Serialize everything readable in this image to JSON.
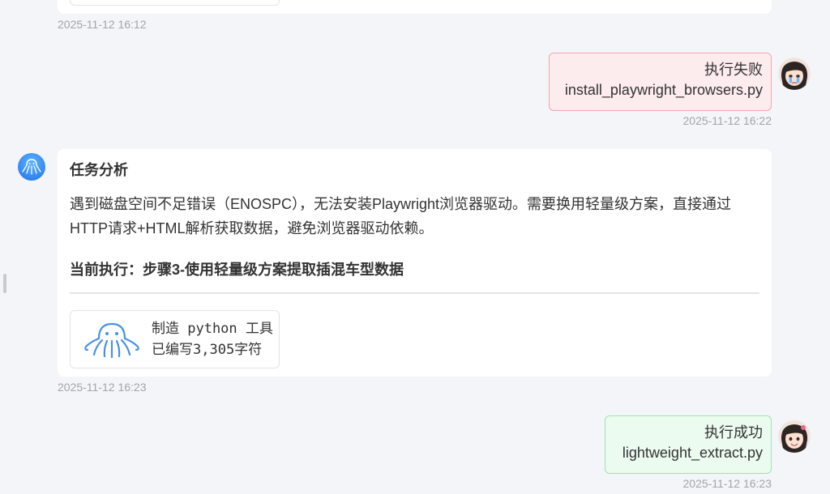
{
  "messages": {
    "prev_bot_timestamp": "2025-11-12 16:12",
    "user_fail": {
      "status": "执行失败",
      "file": "install_playwright_browsers.py",
      "timestamp": "2025-11-12 16:22"
    },
    "bot_analysis": {
      "title": "任务分析",
      "body": "遇到磁盘空间不足错误（ENOSPC），无法安装Playwright浏览器驱动。需要换用轻量级方案，直接通过HTTP请求+HTML解析获取数据，避免浏览器驱动依赖。",
      "current_step": "当前执行：步骤3-使用轻量级方案提取插混车型数据",
      "tool": {
        "name": "制造 python 工具",
        "progress": "已编写3,305字符",
        "icon": "octopus-icon"
      },
      "timestamp": "2025-11-12 16:23"
    },
    "user_ok": {
      "status": "执行成功",
      "file": "lightweight_extract.py",
      "timestamp": "2025-11-12 16:23"
    }
  },
  "colors": {
    "fail_bg": "#fdecee",
    "fail_border": "#f3a6ae",
    "ok_bg": "#ecfbf0",
    "ok_border": "#9ee3b2",
    "accent": "#1f72e8"
  }
}
